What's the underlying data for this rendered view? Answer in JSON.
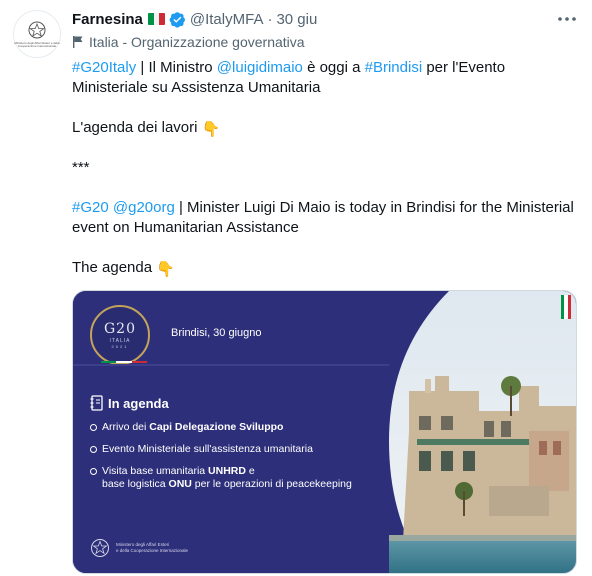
{
  "author": {
    "display_name": "Farnesina",
    "handle": "@ItalyMFA",
    "time": "30 giu",
    "avatar_caption": "Ministero degli Affari Esteri e della Cooperazione Internazionale",
    "label": "Italia - Organizzazione governativa"
  },
  "tweet": {
    "line1": {
      "tag1": "#G20Italy",
      "text1": " | Il Ministro ",
      "mention": "@luigidimaio",
      "text2": " è oggi a ",
      "tag2": "#Brindisi",
      "text3": " per l'Evento"
    },
    "line2": "Ministeriale su Assistenza Umanitaria",
    "line3": "L'agenda dei lavori",
    "line4": "***",
    "line5": {
      "tag": "#G20",
      "mention": "@g20org",
      "text": " | Minister Luigi Di Maio is today in Brindisi for the Ministerial"
    },
    "line6": "event on Humanitarian Assistance",
    "line7": "The agenda",
    "emoji": "👇"
  },
  "card": {
    "logo_main": "G20",
    "logo_sub": "ITALIA",
    "logo_year": "2021",
    "date": "Brindisi, 30 giugno",
    "agenda_title": "In agenda",
    "item1_pre": "Arrivo dei ",
    "item1_bold": "Capi Delegazione Sviluppo",
    "item2": "Evento Ministeriale sull'assistenza umanitaria",
    "item3_a": "Visita base umanitaria ",
    "item3_b": "UNHRD",
    "item3_c": " e",
    "item3_d": "base logistica ",
    "item3_e": "ONU",
    "item3_f": " per le operazioni di peacekeeping",
    "ministry_line1": "Ministero degli Affari Esteri",
    "ministry_line2": "e della Cooperazione Internazionale"
  },
  "colors": {
    "link": "#1d9bf0",
    "card_bg": "#2d2f7a",
    "italy_green": "#009246",
    "italy_white": "#ffffff",
    "italy_red": "#ce2b37"
  },
  "icons": [
    "verified-icon",
    "more-icon",
    "flag-label-icon",
    "notebook-icon",
    "emblem-icon"
  ]
}
